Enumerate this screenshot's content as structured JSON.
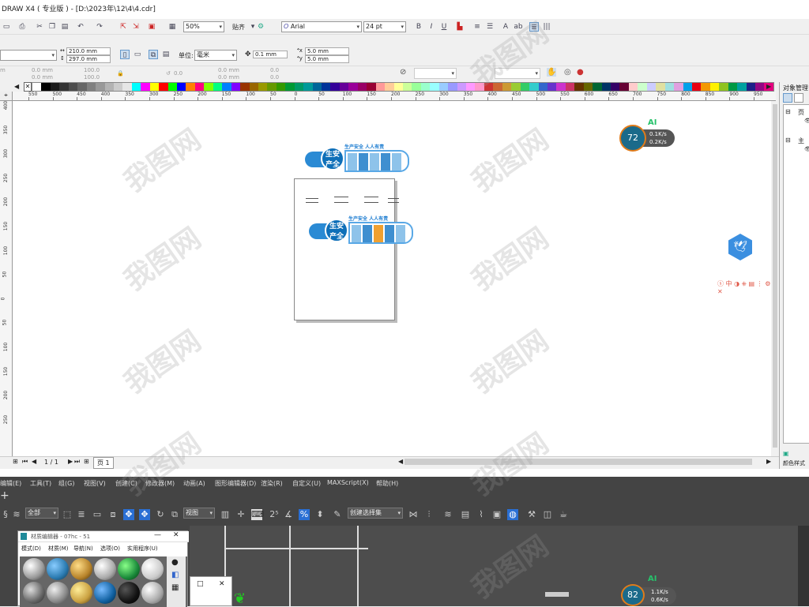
{
  "window": {
    "title": "DRAW X4 ( 专业版 ) - [D:\\2023年\\12\\4\\4.cdr]"
  },
  "toolbar": {
    "zoom": "50%",
    "snap_label": "贴齐",
    "font_name": "Arial",
    "font_size": "24 pt"
  },
  "propbar": {
    "page_width": "210.0 mm",
    "page_height": "297.0 mm",
    "unit_label": "单位:",
    "unit_value": "毫米",
    "nudge": "0.1 mm",
    "dup_x": "5.0 mm",
    "dup_y": "5.0 mm"
  },
  "propbar2": {
    "pos_x": "0.0 mm",
    "pos_y": "0.0 mm",
    "scale_x": "100.0",
    "scale_y": "100.0",
    "rot": "0.0",
    "off1": "0.0 mm",
    "off2": "0.0 mm",
    "a": "0.0",
    "b": "0.0"
  },
  "palette": [
    "#ffffff",
    "#000000",
    "#1a1a1a",
    "#333333",
    "#4d4d4d",
    "#666666",
    "#808080",
    "#999999",
    "#b3b3b3",
    "#cccccc",
    "#e6e6e6",
    "#00ffff",
    "#ff00ff",
    "#ffff00",
    "#ff0000",
    "#00ff00",
    "#0000ff",
    "#ff8000",
    "#ff0080",
    "#80ff00",
    "#00ff80",
    "#0080ff",
    "#8000ff",
    "#993300",
    "#996600",
    "#999900",
    "#669900",
    "#339900",
    "#009933",
    "#009966",
    "#009999",
    "#006699",
    "#003399",
    "#330099",
    "#660099",
    "#990099",
    "#990066",
    "#990033",
    "#ff9999",
    "#ffcc99",
    "#ffff99",
    "#ccff99",
    "#99ff99",
    "#99ffcc",
    "#99ffff",
    "#99ccff",
    "#9999ff",
    "#cc99ff",
    "#ff99ff",
    "#ff99cc",
    "#cc3333",
    "#cc6633",
    "#cc9933",
    "#99cc33",
    "#33cc66",
    "#33cccc",
    "#3366cc",
    "#6633cc",
    "#cc33cc",
    "#cc3366",
    "#663300",
    "#666600",
    "#006633",
    "#003366",
    "#330066",
    "#660033",
    "#ffcccc",
    "#ccffcc",
    "#ccccff",
    "#e0e0a0",
    "#a0e0e0",
    "#e0a0e0",
    "#00a0e9",
    "#e60012",
    "#f39800",
    "#fff100",
    "#8fc31f",
    "#009944",
    "#00a0a0",
    "#1d2088",
    "#920783",
    "#e4007f"
  ],
  "ruler_h": [
    "550",
    "500",
    "450",
    "400",
    "350",
    "300",
    "250",
    "200",
    "150",
    "100",
    "50",
    "0",
    "50",
    "100",
    "150",
    "200",
    "250",
    "300",
    "350",
    "400",
    "450",
    "500",
    "550",
    "600",
    "650",
    "700",
    "750",
    "800",
    "850",
    "900",
    "950"
  ],
  "ruler_v": [
    "400",
    "350",
    "300",
    "250",
    "200",
    "150",
    "100",
    "50",
    "0",
    "50",
    "100",
    "150",
    "200",
    "250"
  ],
  "status": {
    "pages": "1 / 1",
    "page_tab": "页 1"
  },
  "design": {
    "title_small": "生产安全  人人有责",
    "circle_text": "生安\n产全"
  },
  "speed_widget": {
    "pct_top": "72",
    "ai_top": "AI",
    "up_top": "0.1K/s",
    "down_top": "0.2K/s",
    "pct_bottom": "82",
    "ai_bottom": "AI",
    "up_bottom": "1.1K/s",
    "down_bottom": "0.6K/s"
  },
  "right_panel": {
    "title": "对象管理",
    "item1": "页",
    "item2": "主",
    "bottom_label": "颜色样式"
  },
  "max": {
    "menu": [
      "编辑(E)",
      "工具(T)",
      "组(G)",
      "视图(V)",
      "创建(C)",
      "修改器(M)",
      "动画(A)",
      "图形编辑器(D)",
      "渲染(R)",
      "自定义(U)",
      "MAXScript(X)",
      "帮助(H)"
    ],
    "filter": "全部",
    "view": "视图",
    "selset": "创建选择集"
  },
  "material_editor": {
    "title": "材质编辑器 - 07hc - 51",
    "menu": [
      "模式(D)",
      "材质(M)",
      "导航(N)",
      "选项(O)",
      "实用程序(U)"
    ]
  },
  "watermark": "我图网"
}
